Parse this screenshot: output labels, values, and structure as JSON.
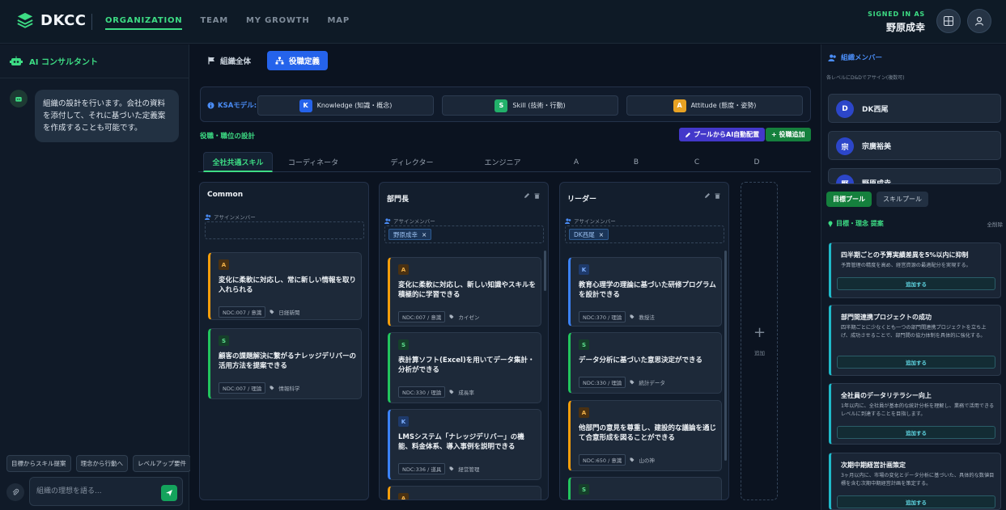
{
  "app": {
    "logo_text": "DKCC",
    "nav": [
      "ORGANIZATION",
      "TEAM",
      "MY GROWTH",
      "MAP"
    ],
    "signed_in_label": "SIGNED IN AS",
    "signed_in_name": "野原成幸"
  },
  "assistant": {
    "title": "AI コンサルタント",
    "message": "組織の設計を行います。会社の資料を添付して、それに基づいた定義案を作成することも可能です。",
    "quick_chips": [
      "目標からスキル提案",
      "理念から行動へ",
      "レベルアップ要件"
    ],
    "input_placeholder": "組織の理想を語る..."
  },
  "main": {
    "tabs": [
      "組織全体",
      "役職定義"
    ],
    "ksa_label": "KSAモデル:",
    "ksa": [
      {
        "letter": "K",
        "label": "Knowledge (知識・概念)"
      },
      {
        "letter": "S",
        "label": "Skill (技術・行動)"
      },
      {
        "letter": "A",
        "label": "Attitude (態度・姿勢)"
      }
    ],
    "design_label": "役職・職位の設計",
    "pool_button": "プールからAI自動配置",
    "add_role_button": "+ 役職追加",
    "role_tabs": [
      "全社共通スキル",
      "コーディネータ",
      "ディレクター",
      "エンジニア",
      "A",
      "B",
      "C",
      "D"
    ],
    "assign_label": "アサインメンバー",
    "add_label": "追加",
    "columns": [
      {
        "title": "Common",
        "members": [],
        "cards": [
          {
            "type": "A",
            "text": "変化に柔軟に対応し、常に新しい情報を取り入れられる",
            "ndc": "NDC:007 / 意識",
            "tag": "日経新聞"
          },
          {
            "type": "S",
            "text": "顧客の課題解決に繋がるナレッジデリバーの活用方法を提案できる",
            "ndc": "NDC:007 / 理論",
            "tag": "情報科学"
          }
        ]
      },
      {
        "title": "部門長",
        "members": [
          "野原成幸"
        ],
        "cards": [
          {
            "type": "A",
            "text": "変化に柔軟に対応し、新しい知識やスキルを積極的に学習できる",
            "ndc": "NDC:007 / 意識",
            "tag": "カイゼン"
          },
          {
            "type": "S",
            "text": "表計算ソフト(Excel)を用いてデータ集計・分析ができる",
            "ndc": "NDC:330 / 理論",
            "tag": "成長率"
          },
          {
            "type": "K",
            "text": "LMSシステム「ナレッジデリバー」の機能、料金体系、導入事例を説明できる",
            "ndc": "NDC:336 / 道具",
            "tag": "経営管理"
          },
          {
            "type": "A",
            "text": "",
            "ndc": "",
            "tag": ""
          }
        ]
      },
      {
        "title": "リーダー",
        "members": [
          "DK西尾"
        ],
        "cards": [
          {
            "type": "K",
            "text": "教育心理学の理論に基づいた研修プログラムを設計できる",
            "ndc": "NDC:370 / 理論",
            "tag": "教授法"
          },
          {
            "type": "S",
            "text": "データ分析に基づいた意思決定ができる",
            "ndc": "NDC:330 / 理論",
            "tag": "統計データ"
          },
          {
            "type": "A",
            "text": "他部門の意見を尊重し、建設的な議論を通じて合意形成を図ることができる",
            "ndc": "NDC:650 / 意識",
            "tag": "山の神"
          },
          {
            "type": "S",
            "text": "",
            "ndc": "",
            "tag": ""
          }
        ]
      }
    ]
  },
  "right": {
    "members_title": "組織メンバー",
    "members_sub": "各レベルにD&Dでアサイン(複数可)",
    "members": [
      {
        "initial": "D",
        "name": "DK西尾"
      },
      {
        "initial": "宗",
        "name": "宗廣裕美"
      },
      {
        "initial": "野",
        "name": "野原成幸"
      }
    ],
    "pool_tabs": [
      "目標プール",
      "スキルプール"
    ],
    "goals_title": "目標・理念 提案",
    "clear_all": "全削除",
    "add_button": "追加する",
    "goals": [
      {
        "title": "四半期ごとの予算実績差異を5%以内に抑制",
        "desc": "予算管理の精度を高め、経営資源の最適配分を実現する。"
      },
      {
        "title": "部門間連携プロジェクトの成功",
        "desc": "四半期ごとに少なくとも一つの部門間連携プロジェクトを立ち上げ、成功させることで、部門間の協力体制を具体的に強化する。"
      },
      {
        "title": "全社員のデータリテラシー向上",
        "desc": "1年以内に、全社員が基本的な統計分析を理解し、業務で活用できるレベルに到達することを目指します。"
      },
      {
        "title": "次期中期経営計画策定",
        "desc": "3ヶ月以内に、市場の変化とデータ分析に基づいた、具体的な数値目標を含む次期中期経営計画を策定する。"
      }
    ]
  },
  "colors": {
    "accent_green": "#3ddc84",
    "accent_blue": "#2563eb",
    "knowledge": "#3b82f6",
    "skill": "#22c55e",
    "attitude": "#f59e0b",
    "goal_accent": "#1fb9c9"
  }
}
